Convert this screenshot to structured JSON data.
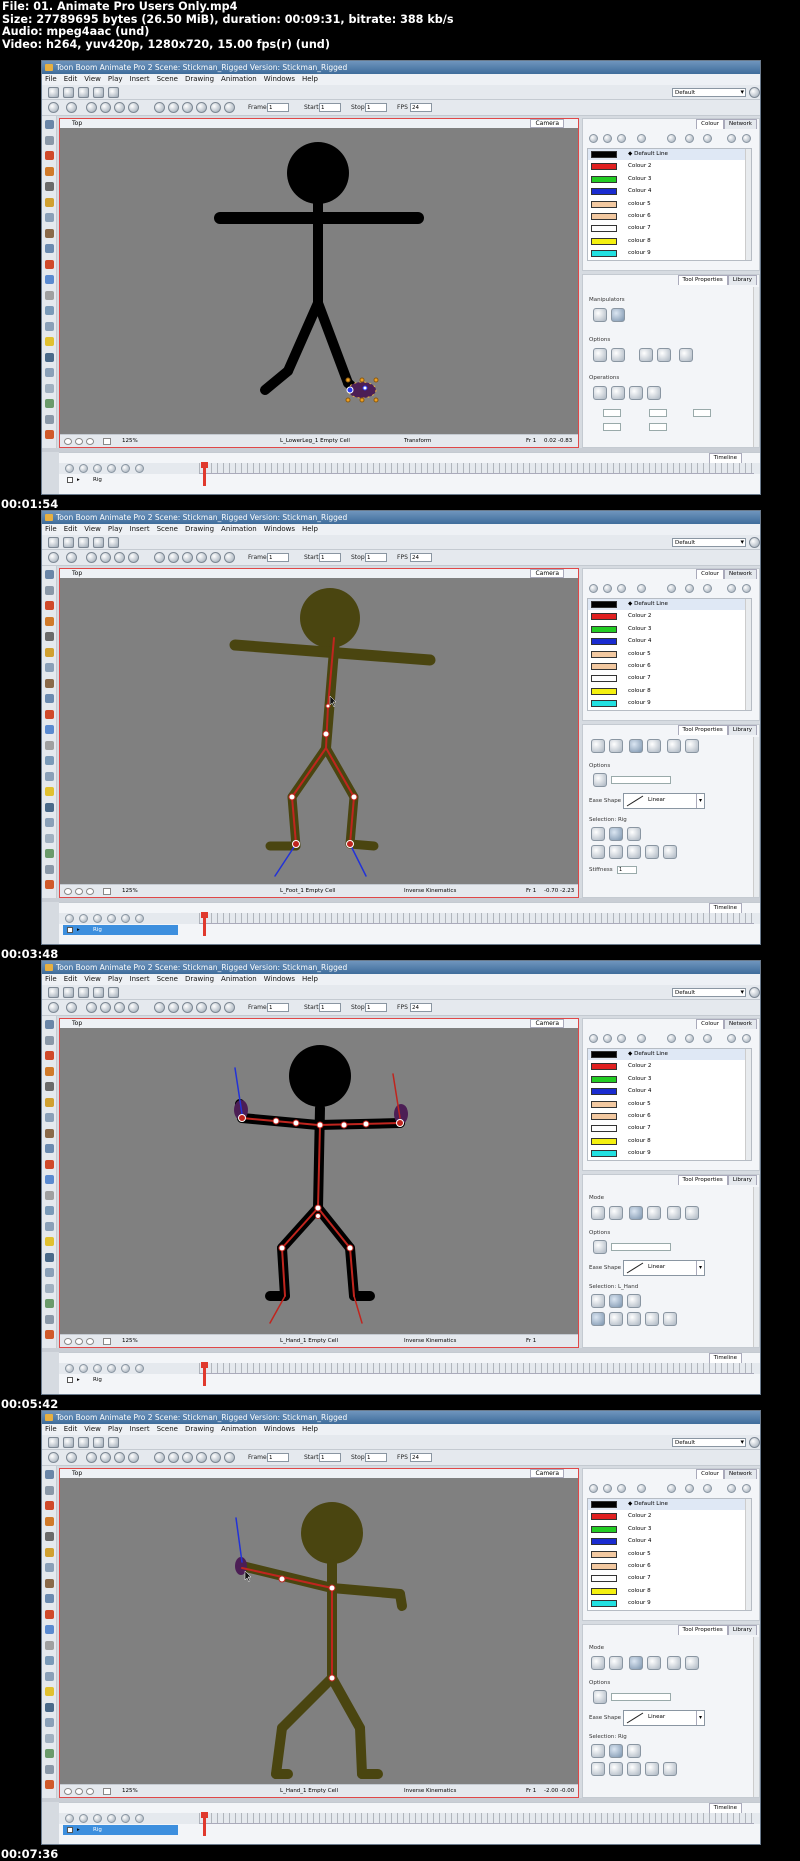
{
  "header": {
    "lines": [
      "File: 01. Animate Pro Users Only.mp4",
      "Size: 27789695 bytes (26.50 MiB), duration: 00:09:31, bitrate: 388 kb/s",
      "Audio: mpeg4aac (und)",
      "Video: h264, yuv420p, 1280x720, 15.00 fps(r) (und)"
    ]
  },
  "common": {
    "window_title": "Toon Boom Animate Pro 2 Scene: Stickman_Rigged Version: Stickman_Rigged",
    "menu": [
      "File",
      "Edit",
      "View",
      "Play",
      "Insert",
      "Scene",
      "Drawing",
      "Animation",
      "Windows",
      "Help"
    ],
    "frame_label": "Frame",
    "frame_value": "1",
    "start_label": "Start",
    "start_value": "1",
    "stop_label": "Stop",
    "stop_value": "1",
    "fps_label": "FPS",
    "fps_value": "24",
    "workspace": "Default",
    "view_top_tab": "Top",
    "camera_tab": "Camera",
    "colour_tab": "Colour",
    "network_tab": "Network",
    "toolprops_tab": "Tool Properties",
    "library_tab": "Library",
    "timeline_tab": "Timeline",
    "zoom": "125%",
    "layer_name": "Rig",
    "ease_shape_label": "Ease Shape",
    "ease_shape_value": "Linear",
    "options_label": "Options",
    "swatches": [
      {
        "name": "Default Line",
        "color": "#000000"
      },
      {
        "name": "Colour 2",
        "color": "#e02020"
      },
      {
        "name": "Colour 3",
        "color": "#22cc22"
      },
      {
        "name": "Colour 4",
        "color": "#1a2bd0"
      },
      {
        "name": "colour 5",
        "color": "#f2c8a0"
      },
      {
        "name": "colour 6",
        "color": "#f2c8a0"
      },
      {
        "name": "colour 7",
        "color": "#ffffff"
      },
      {
        "name": "colour 8",
        "color": "#f4f010"
      },
      {
        "name": "colour 9",
        "color": "#22e0e0"
      }
    ]
  },
  "frames": [
    {
      "timestamp": "",
      "status_cell": "L_LowerLeg_1 Empty Cell",
      "status_tool": "Transform",
      "status_frame": "Fr 1",
      "status_coords": "0.02 -0.83",
      "tp_sections": [
        "Manipulators",
        "Options",
        "Operations"
      ],
      "selection_label": "",
      "stiffness_label": "",
      "stiffness_value": "",
      "layer_selected": false
    },
    {
      "timestamp": "00:01:54",
      "status_cell": "L_Foot_1 Empty Cell",
      "status_tool": "Inverse Kinematics",
      "status_frame": "Fr 1",
      "status_coords": "-0.70 -2.23",
      "tp_sections": [
        "",
        "Options",
        ""
      ],
      "selection_label": "Selection: Rig",
      "stiffness_label": "Stiffness",
      "stiffness_value": "1",
      "layer_selected": true
    },
    {
      "timestamp": "00:03:48",
      "status_cell": "L_Hand_1 Empty Cell",
      "status_tool": "Inverse Kinematics",
      "status_frame": "Fr 1",
      "status_coords": "",
      "tp_sections": [
        "Mode",
        "Options",
        ""
      ],
      "selection_label": "Selection: L_Hand",
      "stiffness_label": "",
      "stiffness_value": "",
      "layer_selected": false
    },
    {
      "timestamp": "00:05:42",
      "status_cell": "L_Hand_1 Empty Cell",
      "status_tool": "Inverse Kinematics",
      "status_frame": "Fr 1",
      "status_coords": "-2.00 -0.00",
      "tp_sections": [
        "Mode",
        "Options",
        ""
      ],
      "selection_label": "Selection: Rig",
      "stiffness_label": "",
      "stiffness_value": "",
      "layer_selected": true
    }
  ],
  "final_timestamp": "00:07:36",
  "colors": {
    "figure_black": "#000000",
    "figure_olive": "#4a4510",
    "bone_red": "#c0251e",
    "ik_blue": "#2232d8",
    "selection_red": "#e04848",
    "timeline_select": "#3d8fde"
  }
}
